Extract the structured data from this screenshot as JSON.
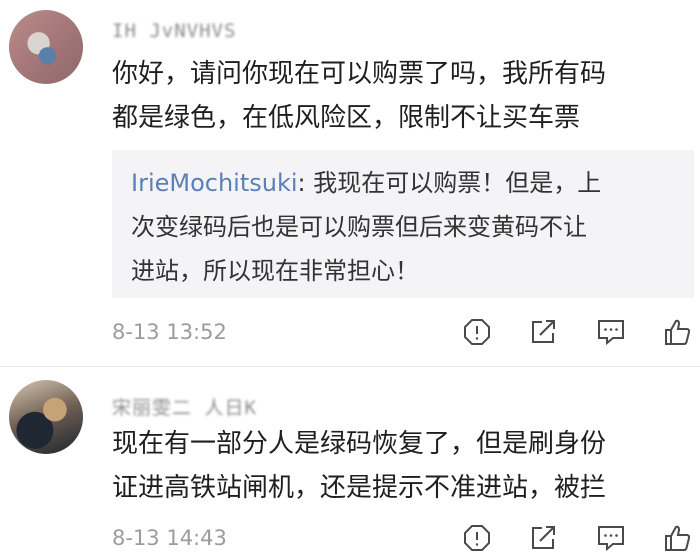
{
  "comments": [
    {
      "username": "IH JvNVHVS",
      "text": "你好，请问你现在可以购票了吗，我所有码\n都是绿色，在低风险区，限制不让买车票",
      "reply": {
        "author": "IrieMochitsuki",
        "separator": ": ",
        "text": "我现在可以购票！但是，上\n次变绿码后也是可以购票但后来变黄码不让\n进站，所以现在非常担心！"
      },
      "time": "8-13 13:52",
      "actions": [
        "report-icon",
        "share-icon",
        "comment-icon",
        "like-icon"
      ]
    },
    {
      "username": "宋丽雯二 人日K",
      "text": "现在有一部分人是绿码恢复了，但是刷身份\n证进高铁站闸机，还是提示不准进站，被拦",
      "time": "8-13 14:43",
      "actions": [
        "report-icon",
        "share-icon",
        "comment-icon",
        "like-icon"
      ]
    }
  ],
  "colors": {
    "icon_stroke": "#4a4a4a",
    "time": "#9c9c9c",
    "reply_author": "#5b7fb8",
    "reply_background": "#f4f4f6"
  }
}
